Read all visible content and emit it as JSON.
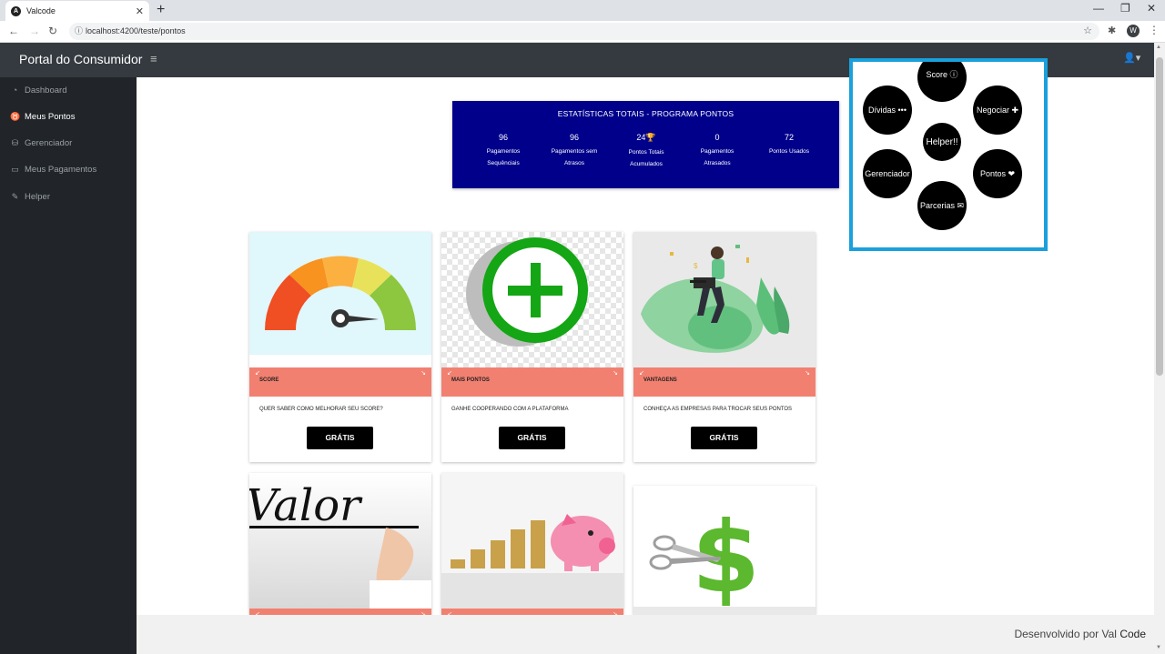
{
  "browser": {
    "tab_title": "Valcode",
    "tab_close": "✕",
    "new_tab": "+",
    "url": "localhost:4200/teste/pontos",
    "profile_initial": "W",
    "win_minimize": "—",
    "win_restore": "❐",
    "win_close": "✕"
  },
  "header": {
    "brand": "Portal do Consumidor",
    "menu_icon": "≡"
  },
  "sidebar": {
    "items": [
      {
        "label": "Dashboard",
        "icon": "dashboard-icon",
        "glyph": "◔"
      },
      {
        "label": "Meus Pontos",
        "icon": "medal-icon",
        "glyph": "♉"
      },
      {
        "label": "Gerenciador",
        "icon": "coins-icon",
        "glyph": "⛁"
      },
      {
        "label": "Meus Pagamentos",
        "icon": "money-icon",
        "glyph": "▭"
      },
      {
        "label": "Helper",
        "icon": "feather-icon",
        "glyph": "✎"
      }
    ]
  },
  "stats": {
    "title": "ESTATÍSTICAS TOTAIS - PROGRAMA PONTOS",
    "items": [
      {
        "value": "96",
        "label1": "Pagamentos",
        "label2": "Sequênciais"
      },
      {
        "value": "96",
        "label1": "Pagamentos sem",
        "label2": "Atrasos"
      },
      {
        "value": "24🏆",
        "label1": "Pontos Totais",
        "label2": "Acumulados"
      },
      {
        "value": "0",
        "label1": "Pagamentos",
        "label2": "Atrasados"
      },
      {
        "value": "72",
        "label1": "Pontos Usados",
        "label2": ""
      }
    ]
  },
  "cards": [
    {
      "label": "SCORE",
      "desc": "QUER SABER COMO MELHORAR SEU SCORE?",
      "button": "GRÁTIS",
      "image": "gauge-image"
    },
    {
      "label": "MAIS PONTOS",
      "desc": "GANHE COOPERANDO COM A PLATAFORMA",
      "button": "GRÁTIS",
      "image": "plus-image"
    },
    {
      "label": "VANTAGENS",
      "desc": "CONHEÇA AS EMPRESAS PARA TROCAR SEUS PONTOS",
      "button": "GRÁTIS",
      "image": "person-laptop-image"
    },
    {
      "image": "valor-image",
      "image_text": "Valor"
    },
    {
      "image": "piggy-bank-image"
    },
    {
      "image": "dollar-scissors-image"
    }
  ],
  "radial_menu": {
    "center": "Helper!!",
    "items": [
      {
        "label": "Score ⓘ"
      },
      {
        "label": "Negociar ✚"
      },
      {
        "label": "Pontos ❤"
      },
      {
        "label": "Parcerias ✉"
      },
      {
        "label": "Gerenciador"
      },
      {
        "label": "Dívidas •••"
      }
    ]
  },
  "footer": {
    "prefix": "Desenvolvido por Val",
    "suffix": "Code"
  }
}
